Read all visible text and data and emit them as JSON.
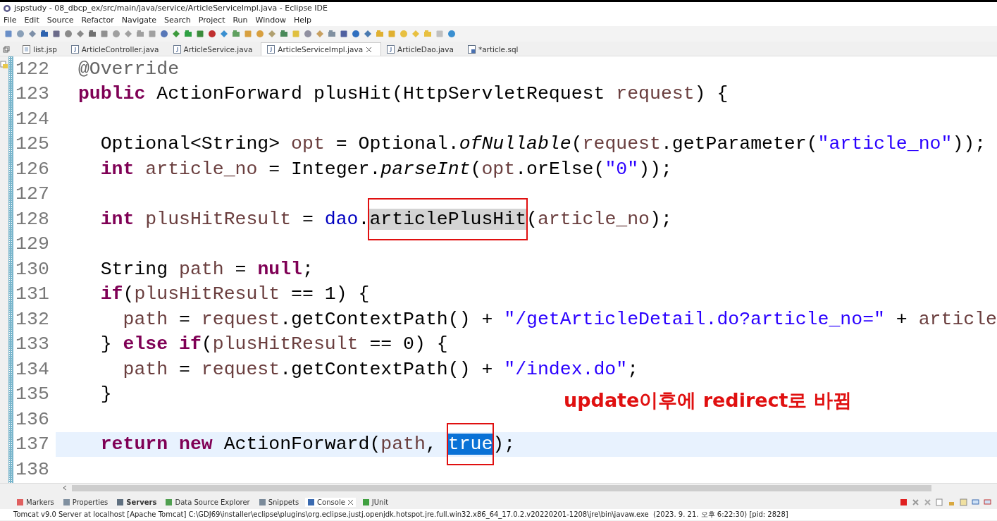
{
  "window": {
    "title": "jspstudy - 08_dbcp_ex/src/main/java/service/ArticleServiceImpl.java - Eclipse IDE"
  },
  "menu": [
    "File",
    "Edit",
    "Source",
    "Refactor",
    "Navigate",
    "Search",
    "Project",
    "Run",
    "Window",
    "Help"
  ],
  "editor_tabs": [
    {
      "label": "list.jsp",
      "kind": "jsp",
      "selected": false
    },
    {
      "label": "ArticleController.java",
      "kind": "java",
      "selected": false
    },
    {
      "label": "ArticleService.java",
      "kind": "java",
      "selected": false
    },
    {
      "label": "ArticleServiceImpl.java",
      "kind": "java",
      "selected": true
    },
    {
      "label": "ArticleDao.java",
      "kind": "java",
      "selected": false
    },
    {
      "label": "*article.sql",
      "kind": "sql",
      "selected": false
    }
  ],
  "code_lines": [
    {
      "number": "122",
      "current": false,
      "tokens": [
        {
          "kind": "ann",
          "text": "  @Override"
        }
      ]
    },
    {
      "number": "123",
      "current": false,
      "tokens": [
        {
          "kind": "kw",
          "text": "  public"
        },
        {
          "kind": "plain",
          "text": " ActionForward plusHit(HttpServletRequest "
        },
        {
          "kind": "var",
          "text": "request"
        },
        {
          "kind": "plain",
          "text": ") {"
        }
      ]
    },
    {
      "number": "124",
      "current": false
    },
    {
      "number": "125",
      "current": false,
      "tokens": [
        {
          "kind": "plain",
          "text": "    Optional<String> "
        },
        {
          "kind": "var",
          "text": "opt"
        },
        {
          "kind": "plain",
          "text": " = Optional."
        },
        {
          "kind": "static",
          "text": "ofNullable"
        },
        {
          "kind": "plain",
          "text": "("
        },
        {
          "kind": "var",
          "text": "request"
        },
        {
          "kind": "plain",
          "text": ".getParameter("
        },
        {
          "kind": "str",
          "text": "\"article_no\""
        },
        {
          "kind": "plain",
          "text": "));"
        }
      ]
    },
    {
      "number": "126",
      "current": false,
      "tokens": [
        {
          "kind": "kw",
          "text": "    int "
        },
        {
          "kind": "var",
          "text": "article_no"
        },
        {
          "kind": "plain",
          "text": " = Integer."
        },
        {
          "kind": "static",
          "text": "parseInt"
        },
        {
          "kind": "plain",
          "text": "("
        },
        {
          "kind": "var",
          "text": "opt"
        },
        {
          "kind": "plain",
          "text": ".orElse("
        },
        {
          "kind": "str",
          "text": "\"0\""
        },
        {
          "kind": "plain",
          "text": "));"
        }
      ]
    },
    {
      "number": "127",
      "current": false
    },
    {
      "number": "128",
      "current": false,
      "tokens": [
        {
          "kind": "kw",
          "text": "    int "
        },
        {
          "kind": "var",
          "text": "plusHitResult"
        },
        {
          "kind": "plain",
          "text": " = "
        },
        {
          "kind": "field",
          "text": "dao"
        },
        {
          "kind": "plain",
          "text": "."
        },
        {
          "kind": "occurrence",
          "text": "articlePlusHit",
          "boxed": true
        },
        {
          "kind": "plain",
          "text": "("
        },
        {
          "kind": "var",
          "text": "article_no"
        },
        {
          "kind": "plain",
          "text": ");"
        }
      ]
    },
    {
      "number": "129",
      "current": false
    },
    {
      "number": "130",
      "current": false,
      "tokens": [
        {
          "kind": "plain",
          "text": "    String "
        },
        {
          "kind": "var",
          "text": "path"
        },
        {
          "kind": "plain",
          "text": " = "
        },
        {
          "kind": "kw",
          "text": "null"
        },
        {
          "kind": "plain",
          "text": ";"
        }
      ]
    },
    {
      "number": "131",
      "current": false,
      "tokens": [
        {
          "kind": "kw",
          "text": "    if"
        },
        {
          "kind": "plain",
          "text": "("
        },
        {
          "kind": "var",
          "text": "plusHitResult"
        },
        {
          "kind": "plain",
          "text": " == 1) {"
        }
      ]
    },
    {
      "number": "132",
      "current": false,
      "tokens": [
        {
          "kind": "var",
          "text": "      path"
        },
        {
          "kind": "plain",
          "text": " = "
        },
        {
          "kind": "var",
          "text": "request"
        },
        {
          "kind": "plain",
          "text": ".getContextPath() + "
        },
        {
          "kind": "str",
          "text": "\"/getArticleDetail.do?article_no=\""
        },
        {
          "kind": "plain",
          "text": " + "
        },
        {
          "kind": "var",
          "text": "article"
        }
      ]
    },
    {
      "number": "133",
      "current": false,
      "tokens": [
        {
          "kind": "plain",
          "text": "    } "
        },
        {
          "kind": "kw",
          "text": "else if"
        },
        {
          "kind": "plain",
          "text": "("
        },
        {
          "kind": "var",
          "text": "plusHitResult"
        },
        {
          "kind": "plain",
          "text": " == 0) {"
        }
      ]
    },
    {
      "number": "134",
      "current": false,
      "tokens": [
        {
          "kind": "var",
          "text": "      path"
        },
        {
          "kind": "plain",
          "text": " = "
        },
        {
          "kind": "var",
          "text": "request"
        },
        {
          "kind": "plain",
          "text": ".getContextPath() + "
        },
        {
          "kind": "str",
          "text": "\"/index.do\""
        },
        {
          "kind": "plain",
          "text": ";"
        }
      ]
    },
    {
      "number": "135",
      "current": false,
      "tokens": [
        {
          "kind": "plain",
          "text": "    }"
        }
      ]
    },
    {
      "number": "136",
      "current": false
    },
    {
      "number": "137",
      "current": true,
      "tokens": [
        {
          "kind": "kw",
          "text": "    return new"
        },
        {
          "kind": "plain",
          "text": " ActionForward("
        },
        {
          "kind": "var",
          "text": "path"
        },
        {
          "kind": "plain",
          "text": ", "
        },
        {
          "kind": "selection",
          "text": "true",
          "boxed": true
        },
        {
          "kind": "plain",
          "text": ");"
        }
      ]
    },
    {
      "number": "138",
      "current": false
    }
  ],
  "annotation": {
    "text": "update이후에 redirect로 바뀜"
  },
  "bottom_tabs": [
    {
      "label": "Markers",
      "selected": false
    },
    {
      "label": "Properties",
      "selected": false
    },
    {
      "label": "Servers",
      "selected": false
    },
    {
      "label": "Data Source Explorer",
      "selected": false
    },
    {
      "label": "Snippets",
      "selected": false
    },
    {
      "label": "Console",
      "selected": true
    },
    {
      "label": "JUnit",
      "selected": false
    }
  ],
  "console": {
    "text": "Tomcat v9.0 Server at localhost [Apache Tomcat] C:\\GDJ69\\installer\\eclipse\\plugins\\org.eclipse.justj.openjdk.hotspot.jre.full.win32.x86_64_17.0.2.v20220201-1208\\jre\\bin\\javaw.exe  (2023. 9. 21. 오후 6:22:30) [pid: 2828]"
  }
}
